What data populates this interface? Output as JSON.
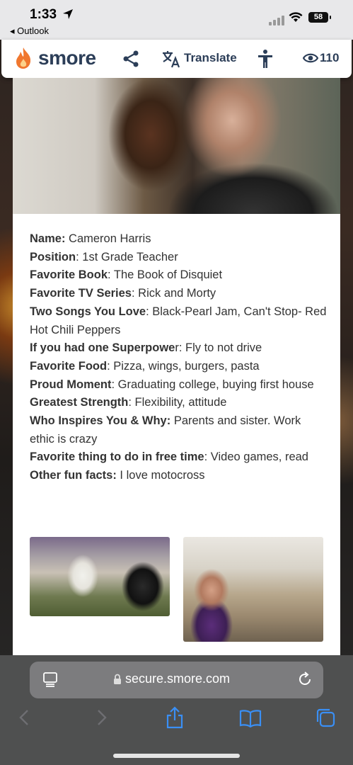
{
  "status_bar": {
    "time": "1:33",
    "back_app": "◂ Outlook",
    "battery": "58"
  },
  "header": {
    "brand": "smore",
    "translate_label": "Translate",
    "view_count": "110"
  },
  "profile": [
    {
      "label": "Name:",
      "value": " Cameron Harris"
    },
    {
      "label": "Position",
      "value": ": 1st Grade Teacher"
    },
    {
      "label": "Favorite Book",
      "value": ": The Book of Disquiet"
    },
    {
      "label": "Favorite TV Series",
      "value": ": Rick and Morty"
    },
    {
      "label": "Two Songs You Love",
      "value": ": Black-Pearl Jam, Can't Stop- Red Hot Chili Peppers"
    },
    {
      "label": "If you had one Superpowe",
      "value": "r: Fly to not drive"
    },
    {
      "label": "Favorite Food",
      "value": ": Pizza, wings, burgers, pasta"
    },
    {
      "label": "Proud Moment",
      "value": ": Graduating college, buying first house"
    },
    {
      "label": "Greatest Strength",
      "value": ": Flexibility, attitude"
    },
    {
      "label": "Who Inspires You & Why:",
      "value": " Parents and sister. Work ethic is crazy"
    },
    {
      "label": "Favorite thing to do in free time",
      "value": ": Video games, read"
    },
    {
      "label": "Other fun facts:",
      "value": " I love motocross"
    }
  ],
  "browser": {
    "url": "secure.smore.com"
  },
  "colors": {
    "brand_text": "#2c3e58",
    "flame": "#f0772e",
    "safari_bar": "#4f5050",
    "link_blue": "#3a8ff5"
  }
}
